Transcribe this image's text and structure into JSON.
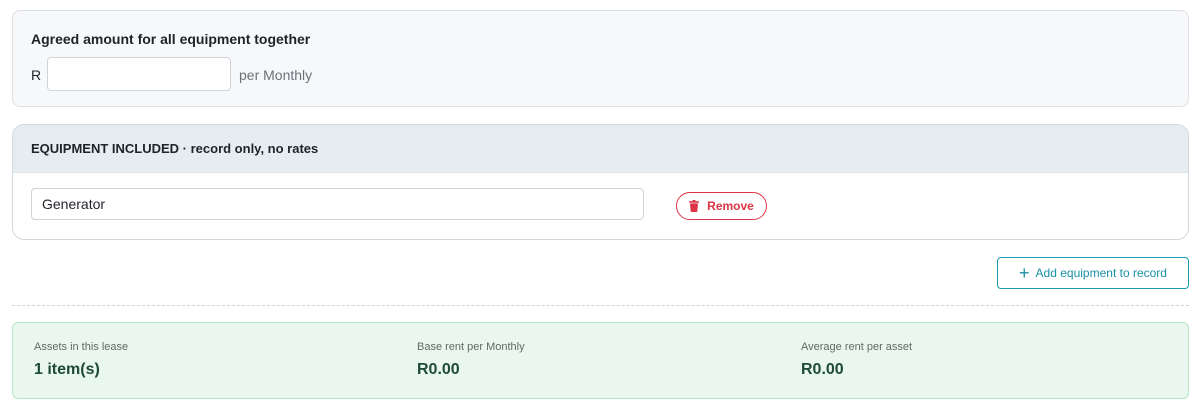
{
  "amount": {
    "title": "Agreed amount for all equipment together",
    "currency": "R",
    "value": "",
    "period": "per Monthly"
  },
  "equipment": {
    "header": "EQUIPMENT INCLUDED · record only, no rates",
    "items": [
      {
        "name": "Generator",
        "remove_label": "Remove"
      }
    ],
    "add_label": "Add equipment to record"
  },
  "summary": [
    {
      "label": "Assets in this lease",
      "value": "1 item(s)"
    },
    {
      "label": "Base rent per Monthly",
      "value": "R0.00"
    },
    {
      "label": "Average rent per asset",
      "value": "R0.00"
    }
  ],
  "colors": {
    "danger": "#dc3545",
    "accent": "#1a9bb0",
    "summary_bg": "#eaf7ef",
    "summary_value": "#1e4a36",
    "header_bg": "#e5edf0"
  },
  "icons": {
    "remove": "trash-icon",
    "add": "plus-icon"
  }
}
